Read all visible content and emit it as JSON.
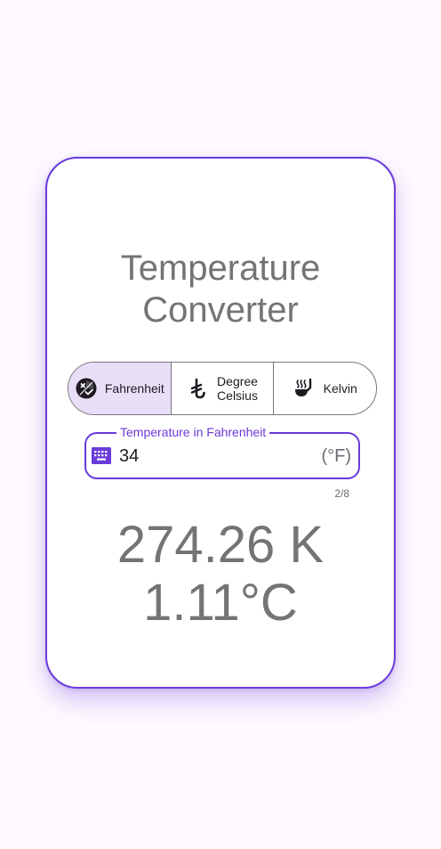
{
  "title": {
    "line1": "Temperature",
    "line2": "Converter"
  },
  "segments": [
    {
      "label": "Fahrenheit",
      "icon": "thermostat-face-icon",
      "selected": true
    },
    {
      "label": "Degree\nCelsius",
      "icon": "celsius-lira-icon",
      "selected": false
    },
    {
      "label": "Kelvin",
      "icon": "hot-ladle-icon",
      "selected": false
    }
  ],
  "input": {
    "label": "Temperature in Fahrenheit",
    "value": "34",
    "suffix": "(°F)",
    "counter": "2/8",
    "icon": "keyboard-icon"
  },
  "results": {
    "kelvin": "274.26 K",
    "celsius": "1.11°C"
  },
  "colors": {
    "accent": "#6a3bd9",
    "selected_bg": "#e8def8",
    "title_text": "#747474",
    "page_bg": "#fefaff"
  }
}
